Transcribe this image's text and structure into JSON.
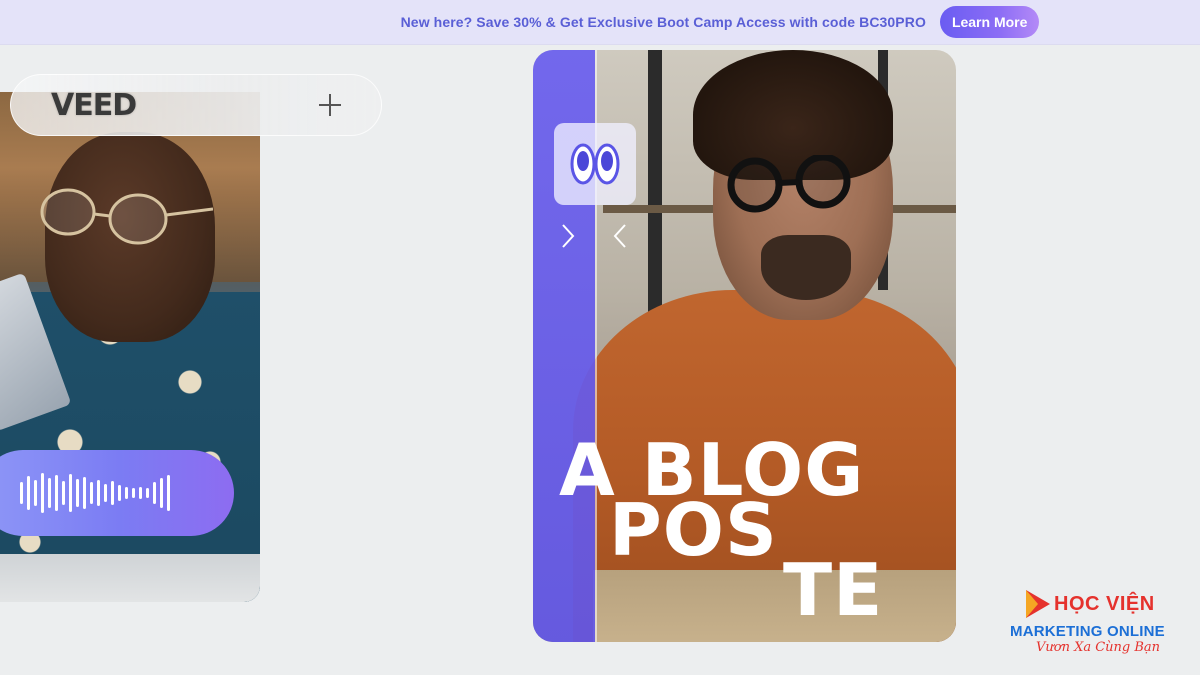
{
  "banner": {
    "text": "New here? Save 30% & Get Exclusive Boot Camp Access with code BC30PRO",
    "button_label": "Learn More"
  },
  "left_card": {
    "brand_logo": "VEED",
    "add_icon": "plus-icon",
    "waveform_icon": "audio-waveform-icon"
  },
  "right_card": {
    "sticker_icon": "googly-eyes-icon",
    "next_icon": "chevron-right-icon",
    "prev_icon": "chevron-left-icon",
    "caption": {
      "line1_faded": "A",
      "line1": "A BLOG",
      "line2": "POS",
      "line3": "TE"
    }
  },
  "watermark": {
    "title": "HỌC VIỆN",
    "subtitle": "MARKETING ONLINE",
    "slogan": "Vươn Xa Cùng Bạn"
  },
  "colors": {
    "banner_bg": "#e4e3f9",
    "banner_text": "#5a5fd6",
    "accent_purple": "#6a5cf2",
    "page_bg": "#eceeef",
    "watermark_red": "#e5322d",
    "watermark_blue": "#1c6fd6"
  }
}
